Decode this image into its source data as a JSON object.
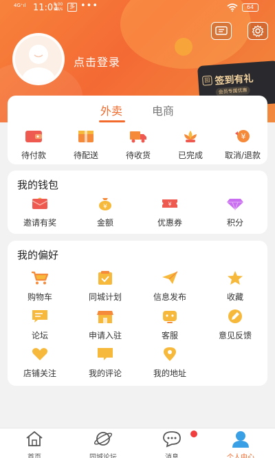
{
  "status_bar": {
    "signal": "4G⁺ıl",
    "time": "11:01",
    "speed_top": "5.00",
    "speed_bottom": "KB/s",
    "bluetooth": "多",
    "dots": "•••",
    "battery": "64"
  },
  "header": {
    "login_text": "点击登录",
    "checkin_title": "签到有礼",
    "checkin_sub": "会员专属优惠",
    "checkin_icon": "回"
  },
  "orders": {
    "tabs": [
      "外卖",
      "电商"
    ],
    "items": [
      {
        "label": "待付款",
        "icon": "wallet-icon"
      },
      {
        "label": "待配送",
        "icon": "package-icon"
      },
      {
        "label": "待收货",
        "icon": "truck-icon"
      },
      {
        "label": "已完成",
        "icon": "lotus-icon"
      },
      {
        "label": "取消/退款",
        "icon": "refund-icon"
      }
    ]
  },
  "wallet": {
    "title": "我的钱包",
    "items": [
      {
        "label": "邀请有奖",
        "icon": "envelope-icon"
      },
      {
        "label": "金额",
        "icon": "money-bag-icon"
      },
      {
        "label": "优惠券",
        "icon": "coupon-icon"
      },
      {
        "label": "积分",
        "icon": "diamond-icon"
      }
    ]
  },
  "prefs": {
    "title": "我的偏好",
    "items": [
      {
        "label": "购物车",
        "icon": "cart-icon"
      },
      {
        "label": "同城计划",
        "icon": "plan-icon"
      },
      {
        "label": "信息发布",
        "icon": "paper-plane-icon"
      },
      {
        "label": "收藏",
        "icon": "star-icon"
      },
      {
        "label": "论坛",
        "icon": "chat-icon"
      },
      {
        "label": "申请入驻",
        "icon": "store-icon"
      },
      {
        "label": "客服",
        "icon": "headset-icon"
      },
      {
        "label": "意见反馈",
        "icon": "pencil-icon"
      },
      {
        "label": "店铺关注",
        "icon": "heart-icon"
      },
      {
        "label": "我的评论",
        "icon": "comment-icon"
      },
      {
        "label": "我的地址",
        "icon": "location-icon"
      }
    ]
  },
  "tabbar": {
    "items": [
      {
        "label": "首页",
        "icon": "home-icon"
      },
      {
        "label": "同城论坛",
        "icon": "planet-icon"
      },
      {
        "label": "消息",
        "icon": "message-icon"
      },
      {
        "label": "个人中心",
        "icon": "person-icon"
      }
    ]
  },
  "colors": {
    "accent": "#f26b2d",
    "header_start": "#f7823b",
    "icon_yellow": "#f6b93b",
    "icon_red": "#ee5a4f",
    "icon_orange": "#f58a3a",
    "purple": "#c96ef0",
    "tab_active": "#3aa0e6"
  }
}
